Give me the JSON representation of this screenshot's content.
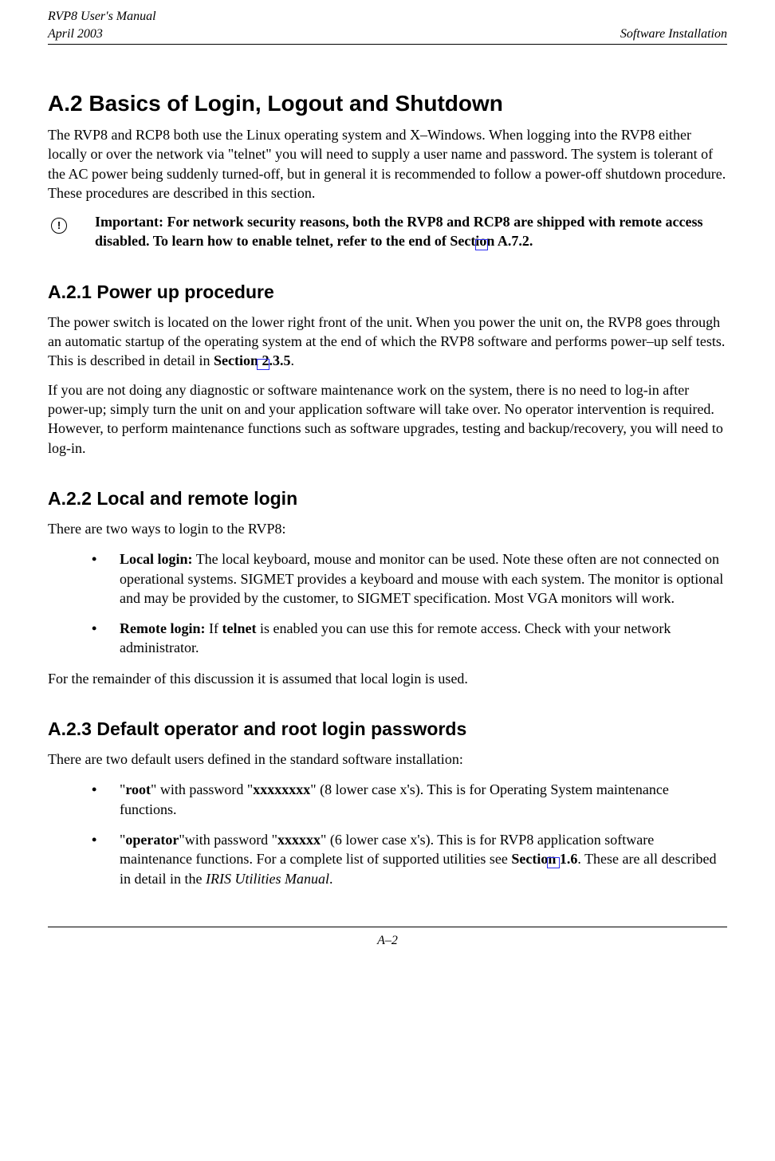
{
  "header": {
    "manual": "RVP8 User's Manual",
    "date": "April 2003",
    "section_title": "Software Installation"
  },
  "s1": {
    "heading": "A.2  Basics of Login, Logout and Shutdown",
    "p1": "The RVP8 and RCP8 both use the Linux operating system and X–Windows. When logging into the RVP8 either locally or over the network via \"telnet\" you will need to supply a user name and password. The system is tolerant of the AC power being suddenly turned-off, but in general it is recommended to follow a power-off shutdown procedure. These procedures are described in this section.",
    "important_prefix": "Important: For network security reasons, both the RVP8 and RCP8 are shipped with remote access disabled. To learn how to enable telnet, refer to the end of ",
    "important_ref": "Section A.7.2",
    "important_suffix": "."
  },
  "s2": {
    "heading": "A.2.1  Power up procedure",
    "p1a": "The power switch is located on the lower right front of the unit.  When you power the unit on, the RVP8 goes through an automatic startup of the operating system at the end of which the RVP8 software and performs power–up self tests. This is described in detail in ",
    "p1ref": "Section 2.3.5",
    "p1b": ".",
    "p2": "If you are not doing any diagnostic or software maintenance work on the system, there is no need to log-in after power-up; simply turn the unit on and your application software will take over. No operator intervention is required. However, to perform maintenance functions such as software upgrades, testing and backup/recovery, you will need to log-in."
  },
  "s3": {
    "heading": "A.2.2  Local and remote login",
    "intro": "There are two ways to login to the RVP8:",
    "b1_label": "Local login:",
    "b1_text": " The local keyboard, mouse and monitor can be used. Note these often are not connected on operational systems. SIGMET provides a keyboard and mouse with each system. The monitor is optional and may be provided by the customer, to SIGMET specification. Most VGA monitors will work.",
    "b2_label": "Remote login:",
    "b2_text1": " If  ",
    "b2_telnet": "telnet",
    "b2_text2": " is enabled you can use this for remote access. Check with your network administrator.",
    "outro": "For the remainder of this discussion it is assumed that local login is used."
  },
  "s4": {
    "heading": "A.2.3  Default operator and root login passwords",
    "intro": "There are two default users defined in the standard software installation:",
    "b1_pre": "\"",
    "b1_user": "root",
    "b1_mid": "\" with   password \"",
    "b1_pass": "xxxxxxxx",
    "b1_post": "\" (8 lower case x's).  This is for Operating System maintenance functions.",
    "b2_pre": "\"",
    "b2_user": "operator",
    "b2_mid": "\"with password \"",
    "b2_pass": "xxxxxx",
    "b2_post1": "\" (6 lower case  x's).  This is for RVP8 application software maintenance functions.  For a complete list of supported utilities see ",
    "b2_ref": "Section 1.6",
    "b2_post2": ". These are all described in detail in the ",
    "b2_italic": "IRIS Utilities Manual",
    "b2_post3": "."
  },
  "footer": {
    "page": "A–2"
  }
}
